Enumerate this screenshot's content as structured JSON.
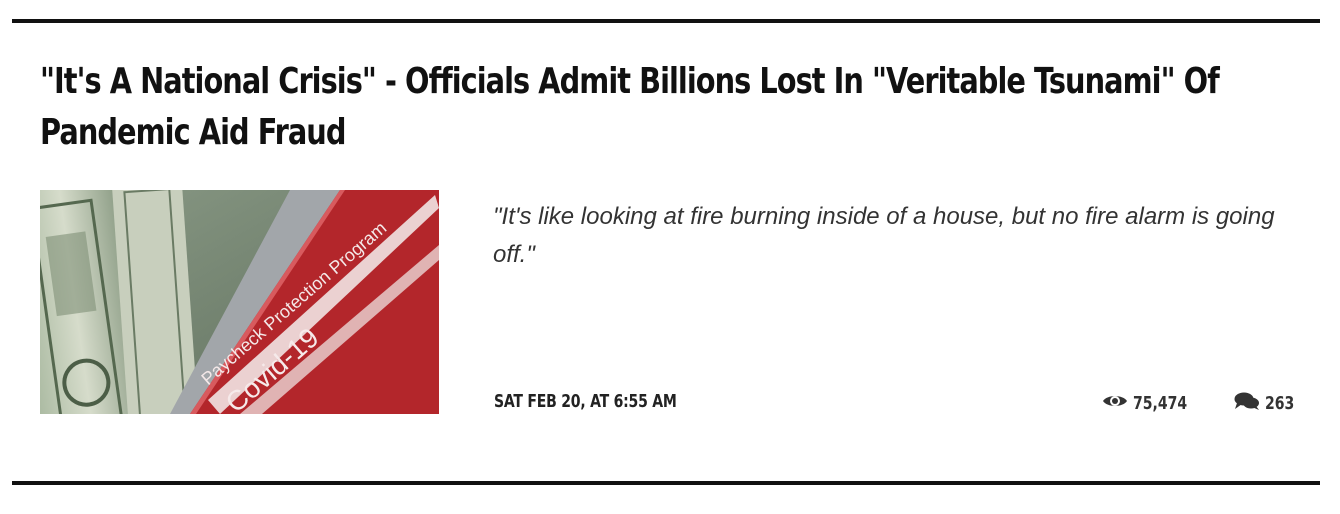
{
  "article": {
    "headline": "\"It's A National Crisis\" - Officials Admit Billions Lost In \"Veritable Tsunami\" Of Pandemic Aid Fraud",
    "excerpt": "\"It's like looking at fire burning inside of a house, but no fire alarm is going off.\"",
    "date": "SAT FEB 20, AT 6:55 AM",
    "views": "75,474",
    "comments": "263",
    "image_text": {
      "line1": "Paycheck Protection Program",
      "line2": "Covid-19"
    }
  },
  "icons": {
    "views": "eye-icon",
    "comments": "comments-icon"
  },
  "colors": {
    "rule": "#111111",
    "form_red": "#b3262b",
    "text": "#222222"
  }
}
